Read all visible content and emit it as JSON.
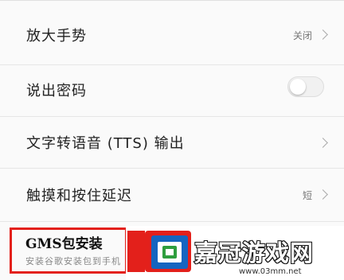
{
  "settings": {
    "magnify_gesture": {
      "label": "放大手势",
      "value": "关闭"
    },
    "speak_passwords": {
      "label": "说出密码",
      "toggle_on": false
    },
    "tts_output": {
      "label": "文字转语音 (TTS) 输出"
    },
    "touch_hold_delay": {
      "label": "触摸和按住延迟",
      "value": "短"
    },
    "gms_package": {
      "title": "GMS包安装",
      "subtitle": "安装谷歌安装包到手机"
    }
  },
  "watermark": {
    "site_name": "嘉冠游戏网",
    "url": "www.03mm.net",
    "colors": {
      "red": "#e3201b",
      "blue": "#1565c0",
      "green": "#2e9e3e"
    }
  },
  "colors": {
    "highlight": "#e3201b",
    "background": "#fafafa"
  }
}
